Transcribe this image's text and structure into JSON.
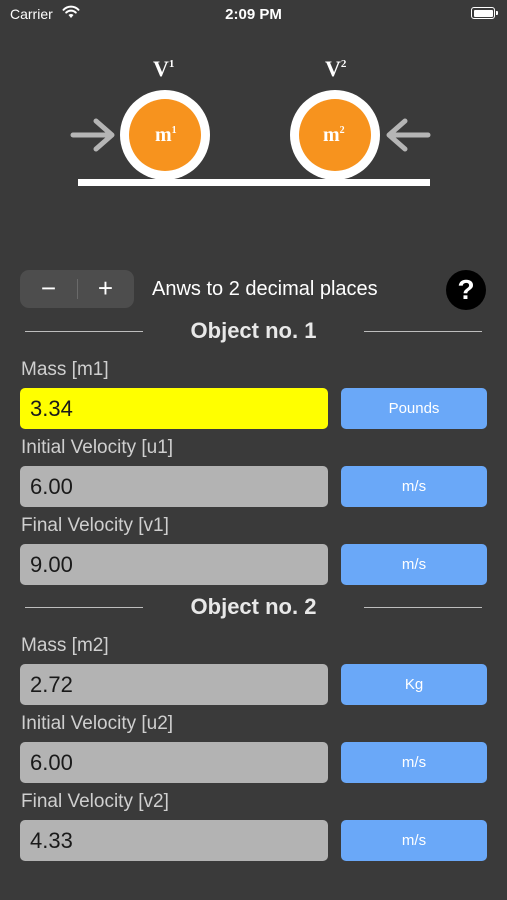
{
  "status_bar": {
    "carrier": "Carrier",
    "time": "2:09 PM"
  },
  "diagram": {
    "velocity1_label": "V",
    "velocity1_sup": "1",
    "velocity2_label": "V",
    "velocity2_sup": "2",
    "mass1_label": "m",
    "mass1_sup": "1",
    "mass2_label": "m",
    "mass2_sup": "2",
    "ball_color": "#f7931e"
  },
  "controls": {
    "minus_label": "−",
    "plus_label": "+",
    "decimal_text": "Anws to 2 decimal places",
    "help_label": "?"
  },
  "object1": {
    "title": "Object no. 1",
    "mass": {
      "label": "Mass [m1]",
      "value": "3.34",
      "unit": "Pounds"
    },
    "initial_velocity": {
      "label": "Initial Velocity [u1]",
      "value": "6.00",
      "unit": "m/s"
    },
    "final_velocity": {
      "label": "Final Velocity [v1]",
      "value": "9.00",
      "unit": "m/s"
    }
  },
  "object2": {
    "title": "Object no. 2",
    "mass": {
      "label": "Mass [m2]",
      "value": "2.72",
      "unit": "Kg"
    },
    "initial_velocity": {
      "label": "Initial Velocity [u2]",
      "value": "6.00",
      "unit": "m/s"
    },
    "final_velocity": {
      "label": "Final Velocity [v2]",
      "value": "4.33",
      "unit": "m/s"
    }
  }
}
